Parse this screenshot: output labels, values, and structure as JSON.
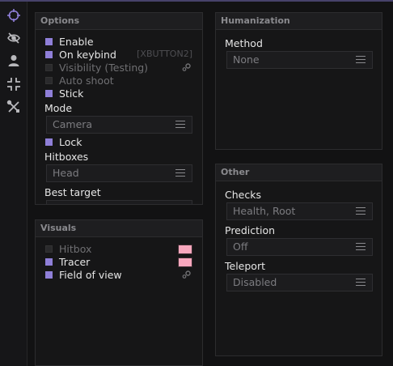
{
  "sidebar": {
    "items": [
      {
        "icon": "crosshair-icon",
        "active": true
      },
      {
        "icon": "eye-off-icon"
      },
      {
        "icon": "person-icon"
      },
      {
        "icon": "compress-icon"
      },
      {
        "icon": "tools-icon"
      }
    ],
    "accent": "#8f7fd8"
  },
  "options": {
    "title": "Options",
    "enable": {
      "label": "Enable",
      "checked": true
    },
    "on_keybind": {
      "label": "On keybind",
      "checked": true,
      "key": "[XBUTTON2]"
    },
    "visibility": {
      "label": "Visibility (Testing)",
      "checked": false
    },
    "auto_shoot": {
      "label": "Auto shoot",
      "checked": false
    },
    "stick": {
      "label": "Stick",
      "checked": true
    },
    "mode": {
      "label": "Mode",
      "value": "Camera"
    },
    "lock": {
      "label": "Lock",
      "checked": true
    },
    "hitboxes": {
      "label": "Hitboxes",
      "value": "Head"
    },
    "best_target": {
      "label": "Best target"
    }
  },
  "visuals": {
    "title": "Visuals",
    "hitbox": {
      "label": "Hitbox",
      "checked": false,
      "color": "#f7a7bd"
    },
    "tracer": {
      "label": "Tracer",
      "checked": true,
      "color": "#f7a7bd"
    },
    "fov": {
      "label": "Field of view",
      "checked": true
    }
  },
  "humanization": {
    "title": "Humanization",
    "method": {
      "label": "Method",
      "value": "None"
    }
  },
  "other": {
    "title": "Other",
    "checks": {
      "label": "Checks",
      "value": "Health, Root"
    },
    "prediction": {
      "label": "Prediction",
      "value": "Off"
    },
    "teleport": {
      "label": "Teleport",
      "value": "Disabled"
    }
  }
}
